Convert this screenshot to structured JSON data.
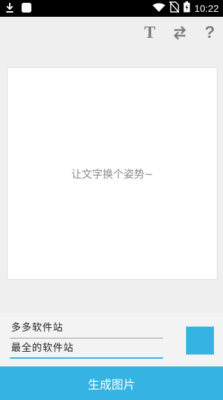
{
  "status_bar": {
    "time": "10:22",
    "icons": [
      "download-icon",
      "notification-icon",
      "wifi-icon",
      "no-sim-icon",
      "battery-charging-icon"
    ]
  },
  "toolbar": {
    "text_button_glyph": "T",
    "swap_icon": "swap-arrows-icon",
    "help_button_glyph": "?"
  },
  "preview": {
    "placeholder": "让文字换个姿势~"
  },
  "inputs": {
    "line1_value": "多多软件站",
    "line2_value": "最全的软件站"
  },
  "color_swatch": {
    "color": "#35b3e3"
  },
  "generate_button": {
    "label": "生成图片"
  }
}
